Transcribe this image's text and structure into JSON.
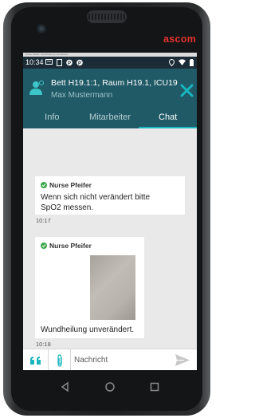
{
  "device": {
    "brand": "ascom"
  },
  "statusbar": {
    "notification_text": "Nurse Pfeifer: Wundheilung unverändert.",
    "time": "10:34"
  },
  "header": {
    "title": "Bett H19.1:1, Raum H19.1, ICU19",
    "subtitle": "Max Mustermann",
    "icons": {
      "patient": "patient-icon",
      "close": "close-icon"
    },
    "accent_color": "#1f5a66",
    "close_color": "#19b6c0"
  },
  "tabs": [
    {
      "label": "Info",
      "active": false
    },
    {
      "label": "Mitarbeiter",
      "active": false
    },
    {
      "label": "Chat",
      "active": true
    }
  ],
  "messages": [
    {
      "sender": "Nurse Pfeifer",
      "text_line1": "Wenn sich nicht verändert bitte",
      "text_line2": "SpO2 messen.",
      "time": "10:17"
    },
    {
      "sender": "Nurse Pfeifer",
      "has_image": true,
      "text_line1": "Wundheilung unverändert.",
      "time": "10:18"
    }
  ],
  "input": {
    "placeholder": "Nachricht",
    "icons": {
      "quote": "quote-icon",
      "attach": "paperclip-icon",
      "send": "send-icon"
    }
  },
  "navbar": {
    "icons": [
      "back-icon",
      "home-icon",
      "recents-icon"
    ]
  }
}
